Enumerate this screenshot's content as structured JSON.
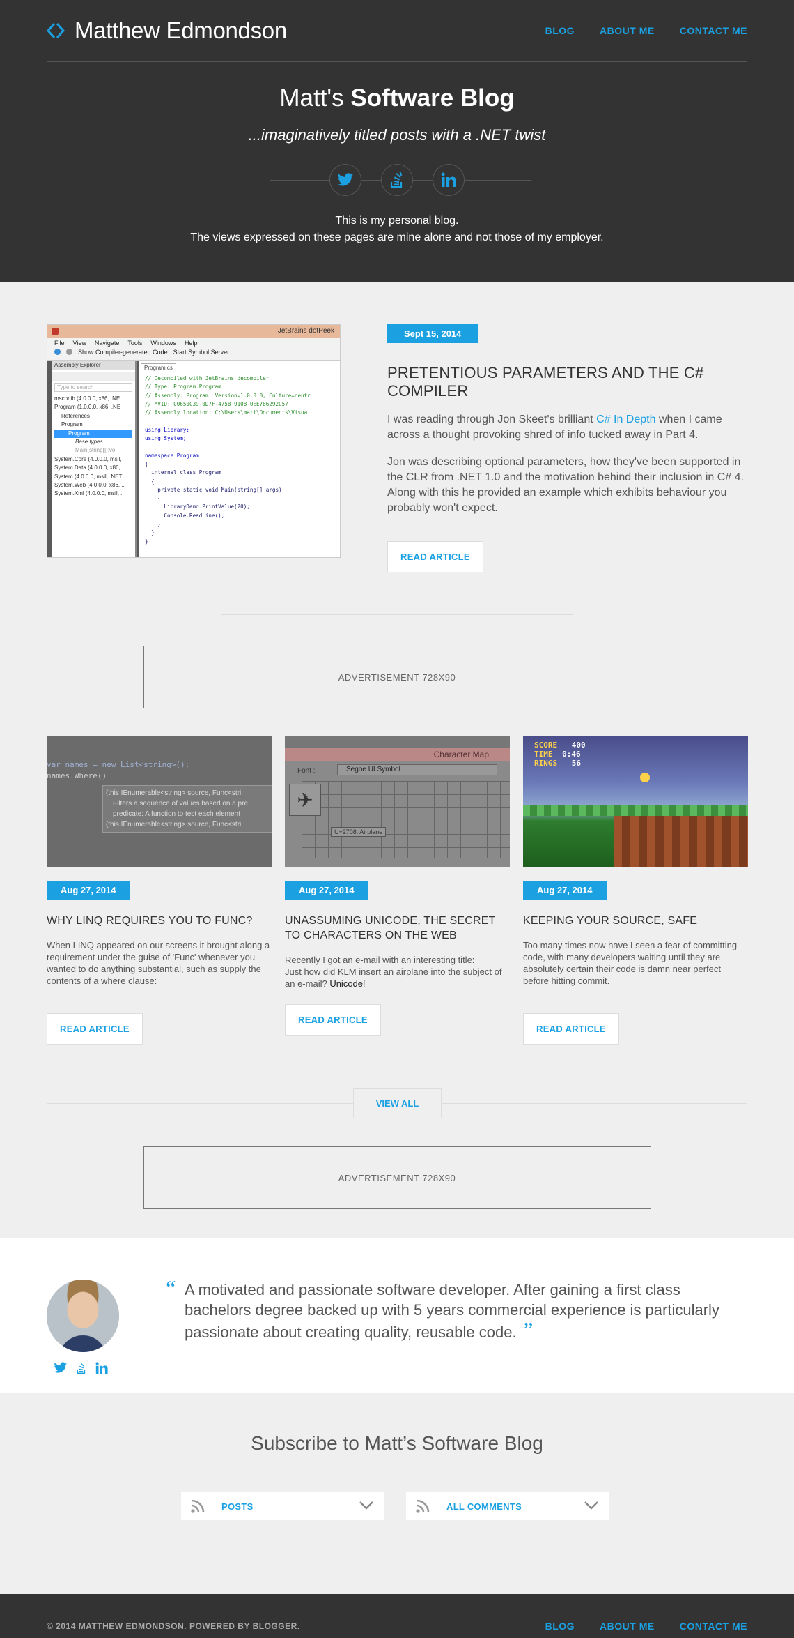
{
  "header": {
    "brand_name": "Matthew Edmondson",
    "nav": [
      "BLOG",
      "ABOUT ME",
      "CONTACT ME"
    ],
    "title_prefix": "Matt's",
    "title_bold": "Software Blog",
    "tagline": "...imaginatively titled posts with a .NET twist",
    "disclaimer_line1": "This is my personal blog.",
    "disclaimer_line2": "The views expressed on these pages are mine alone and not those of my employer."
  },
  "featured": {
    "date": "Sept 15, 2014",
    "title": "PRETENTIOUS PARAMETERS AND THE C# COMPILER",
    "p1_before": "I was reading through Jon Skeet's brilliant ",
    "p1_link": "C# In Depth",
    "p1_after": " when I came across a thought provoking shred of info tucked away in Part 4.",
    "p2": "Jon was describing optional parameters, how they've been supported in the CLR from .NET 1.0 and the motivation behind their inclusion in C# 4. Along with this he provided an example which exhibits behaviour you probably won't expect.",
    "read_label": "READ ARTICLE",
    "screenshot": {
      "app_title": "JetBrains dotPeek",
      "menu": [
        "File",
        "View",
        "Navigate",
        "Tools",
        "Windows",
        "Help"
      ],
      "toolbar_text": "Show Compiler-generated Code",
      "toolbar_text2": "Start Symbol Server",
      "panel_title": "Assembly Explorer",
      "search_placeholder": "Type to search",
      "tree": [
        "mscorlib (4.0.0.0, x86, .NE",
        "Program (1.0.0.0, x86, .NE",
        "References",
        "Program",
        "Program",
        "Base types",
        "Main(string[]):vo",
        "System.Core (4.0.0.0, msil,",
        "System.Data (4.0.0.0, x86, .",
        "System (4.0.0.0, msil, .NET",
        "System.Web (4.0.0.0, x86, ..",
        "System.Xml (4.0.0.0, msil, ."
      ],
      "tab": "Program.cs",
      "code": [
        "// Decompiled with JetBrains decompiler",
        "// Type: Program.Program",
        "// Assembly: Program, Version=1.0.0.0, Culture=neutr",
        "// MVID: C0650C39-0D7F-4758-9108-0EE786292C57",
        "// Assembly location: C:\\Users\\matt\\Documents\\Visua",
        "",
        "using Library;",
        "using System;",
        "",
        "namespace Program",
        "{",
        "  internal class Program",
        "  {",
        "    private static void Main(string[] args)",
        "    {",
        "      LibraryDemo.PrintValue(20);",
        "      Console.ReadLine();",
        "    }",
        "  }",
        "}"
      ]
    }
  },
  "ads": [
    "ADVERTISEMENT 728X90",
    "ADVERTISEMENT 728X90"
  ],
  "cards": [
    {
      "date": "Aug 27, 2014",
      "title": "WHY LINQ REQUIRES YOU TO FUNC?",
      "text": "When LINQ appeared on our screens it brought along a requirement under the guise of 'Func' whenever you wanted to do anything substantial, such as supply the contents of a where clause:",
      "read_label": "READ ARTICLE",
      "img_code1": "var names = new List<string>();",
      "img_code2": "names.Where()",
      "img_tip1": "(this IEnumerable<string> source, Func<stri",
      "img_tip2": "Filters a sequence of values based on a pre",
      "img_tip3": "predicate: A function to test each element",
      "img_tip4": "(this IEnumerable<string> source, Func<stri"
    },
    {
      "date": "Aug 27, 2014",
      "title": "UNASSUMING UNICODE, THE SECRET TO CHARACTERS ON THE WEB",
      "text_line1": "Recently I got an e-mail with an interesting title:",
      "text_line2_before": "Just how did KLM insert an airplane into the subject of an e-mail? ",
      "text_line2_bold": "Unicode",
      "text_line2_after": "!",
      "read_label": "READ ARTICLE",
      "img_title": "Character Map",
      "img_font_label": "Font :",
      "img_font_value": "Segoe UI Symbol",
      "img_tip": "U+2708: Airplane"
    },
    {
      "date": "Aug 27, 2014",
      "title": "KEEPING YOUR SOURCE, SAFE",
      "text": "Too many times now have I seen a fear of committing code, with many developers waiting until they are absolutely certain their code is damn near perfect before hitting commit.",
      "read_label": "READ ARTICLE",
      "img_score_label": "SCORE",
      "img_score": "400",
      "img_time_label": "TIME",
      "img_time": "0:46",
      "img_rings_label": "RINGS",
      "img_rings": "56"
    }
  ],
  "view_all": "VIEW ALL",
  "about": {
    "quote": "A motivated and passionate software developer. After gaining a first class bachelors degree backed up with 5 years commercial experience is particularly passionate about creating quality, reusable code."
  },
  "subscribe": {
    "title": "Subscribe to Matt’s Software Blog",
    "options": [
      "POSTS",
      "ALL COMMENTS"
    ]
  },
  "footer": {
    "copyright": "© 2014 MATTHEW EDMONDSON. POWERED BY BLOGGER.",
    "nav": [
      "BLOG",
      "ABOUT ME",
      "CONTACT ME"
    ]
  },
  "colors": {
    "accent": "#1ba1e2",
    "dark": "#333333",
    "light_bg": "#efefef"
  },
  "icons": [
    "code-brackets-icon",
    "twitter-icon",
    "stackoverflow-icon",
    "linkedin-icon",
    "rss-icon",
    "chevron-down-icon"
  ]
}
